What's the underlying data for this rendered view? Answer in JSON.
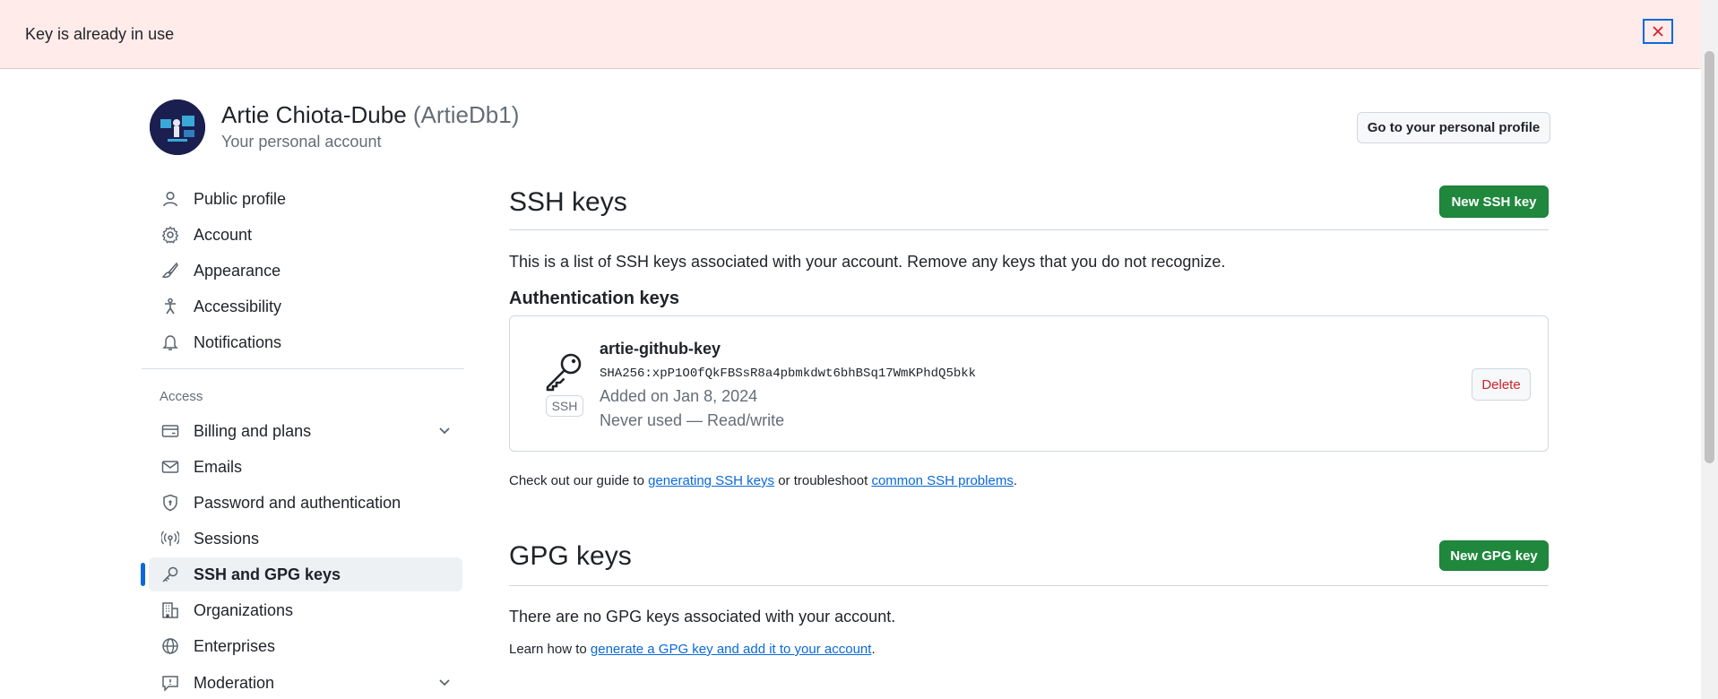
{
  "flash": {
    "message": "Key is already in use",
    "close_icon": "x-icon"
  },
  "profile": {
    "name": "Artie Chiota-Dube",
    "login": "(ArtieDb1)",
    "subtitle": "Your personal account",
    "go_to_profile_label": "Go to your personal profile"
  },
  "sidebar": {
    "items_top": [
      {
        "label": "Public profile",
        "icon": "person-icon"
      },
      {
        "label": "Account",
        "icon": "gear-icon"
      },
      {
        "label": "Appearance",
        "icon": "paintbrush-icon"
      },
      {
        "label": "Accessibility",
        "icon": "accessibility-icon"
      },
      {
        "label": "Notifications",
        "icon": "bell-icon"
      }
    ],
    "access_heading": "Access",
    "items_access": [
      {
        "label": "Billing and plans",
        "icon": "credit-card-icon"
      },
      {
        "label": "Emails",
        "icon": "mail-icon"
      },
      {
        "label": "Password and authentication",
        "icon": "shield-lock-icon"
      },
      {
        "label": "Sessions",
        "icon": "broadcast-icon"
      },
      {
        "label": "SSH and GPG keys",
        "icon": "key-icon"
      },
      {
        "label": "Organizations",
        "icon": "organization-icon"
      },
      {
        "label": "Enterprises",
        "icon": "globe-icon"
      },
      {
        "label": "Moderation",
        "icon": "report-icon"
      }
    ]
  },
  "ssh": {
    "title": "SSH keys",
    "new_button": "New SSH key",
    "description": "This is a list of SSH keys associated with your account. Remove any keys that you do not recognize.",
    "auth_heading": "Authentication keys",
    "key": {
      "title": "artie-github-key",
      "fingerprint": "SHA256:xpP1O0fQkFBSsR8a4pbmkdwt6bhBSq17WmKPhdQ5bkk",
      "added": "Added on Jan 8, 2024",
      "usage": "Never used — Read/write",
      "badge": "SSH",
      "delete_label": "Delete"
    },
    "guide_prefix": "Check out our guide to ",
    "guide_link1": "generating SSH keys",
    "guide_middle": " or troubleshoot ",
    "guide_link2": "common SSH problems",
    "guide_suffix": "."
  },
  "gpg": {
    "title": "GPG keys",
    "new_button": "New GPG key",
    "empty_text": "There are no GPG keys associated with your account.",
    "learn_prefix": "Learn how to ",
    "learn_link": "generate a GPG key and add it to your account",
    "learn_suffix": "."
  },
  "colors": {
    "primary": "#1f883d",
    "accent": "#0969da",
    "danger": "#cf222e",
    "flash_bg": "#ffebe9"
  }
}
